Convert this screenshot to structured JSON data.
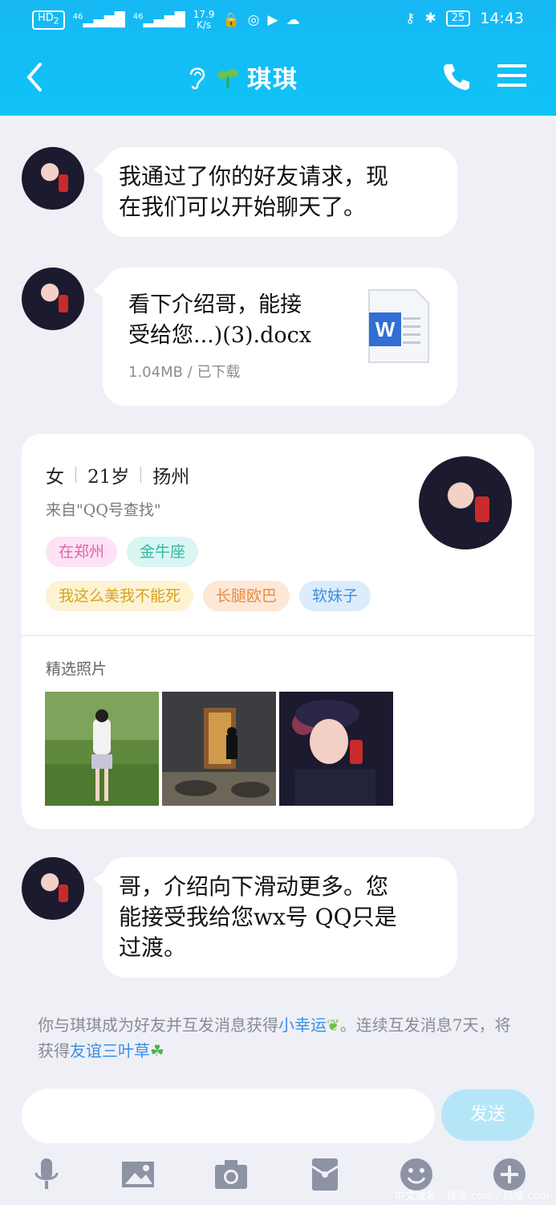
{
  "status_bar": {
    "hd": "HD",
    "hd_sub": "2",
    "sig1": "46",
    "sig2": "46",
    "speed_value": "17.9",
    "speed_unit": "K/s",
    "battery": "25",
    "time": "14:43"
  },
  "header": {
    "title": "琪琪",
    "colors": {
      "gradient_top": "#16b8f4",
      "gradient_bottom": "#0fc3f6"
    }
  },
  "messages": [
    {
      "type": "text",
      "text_line1": "我通过了你的好友请求，现",
      "text_line2": "在我们可以开始聊天了。"
    },
    {
      "type": "file",
      "name_line1": "看下介绍哥，能接",
      "name_line2": "受给您...)(3).docx",
      "meta": "1.04MB / 已下载",
      "icon": "word-document-icon"
    },
    {
      "type": "text",
      "text_line1": "哥，介绍向下滑动更多。您",
      "text_line2": "能接受我给您wx号 QQ只是",
      "text_line3": "过渡。"
    }
  ],
  "profile_card": {
    "gender": "女",
    "age": "21岁",
    "city": "扬州",
    "source": "来自\"QQ号查找\"",
    "tags_row1": [
      {
        "label": "在郑州",
        "bg": "#fde3f3",
        "color": "#e063b5"
      },
      {
        "label": "金牛座",
        "bg": "#d9f6f2",
        "color": "#2fb8a4"
      }
    ],
    "tags_row2": [
      {
        "label": "我这么美我不能死",
        "bg": "#fdf3d3",
        "color": "#d8a21d"
      },
      {
        "label": "长腿欧巴",
        "bg": "#fde8d8",
        "color": "#e68a3f"
      },
      {
        "label": "软妹子",
        "bg": "#dcecfb",
        "color": "#3f8fe0"
      }
    ],
    "photos_label": "精选照片"
  },
  "notice": {
    "part1": "你与琪琪成为好友并互发消息获得",
    "link1": "小幸运",
    "part2": "。连续互发消息7天，将获得",
    "link2": "友谊三叶草"
  },
  "composer": {
    "input_value": "",
    "send_label": "发送"
  },
  "toolbar_icons": [
    "microphone-icon",
    "image-icon",
    "camera-icon",
    "red-packet-icon",
    "emoji-icon",
    "plus-icon"
  ],
  "watermark": "中文域名：楼凤.com / 凤楼.com"
}
